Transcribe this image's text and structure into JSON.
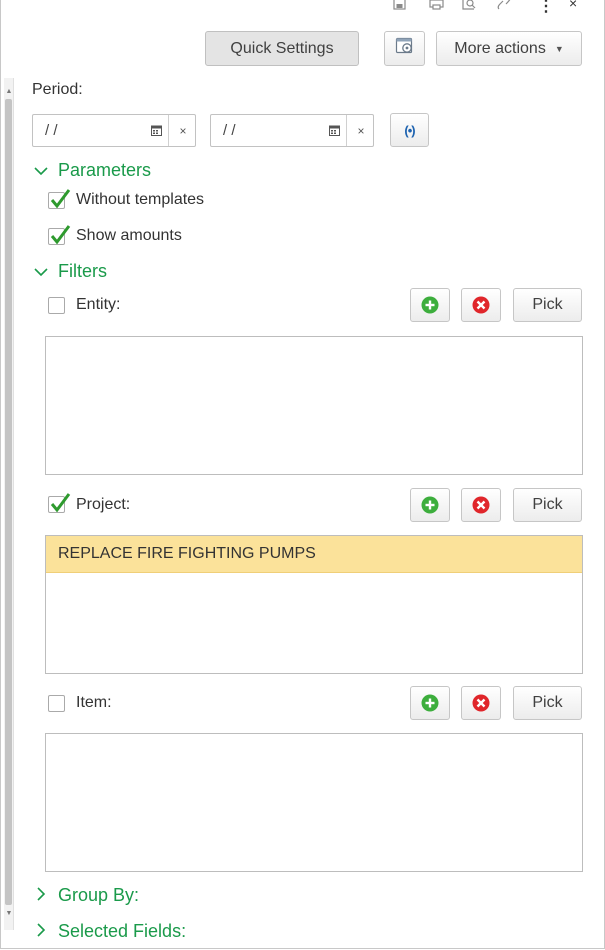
{
  "toolbar": {
    "quick_settings_label": "Quick Settings",
    "more_actions_label": "More actions",
    "settings_icon": "report-settings-icon",
    "top_icons": [
      "save-icon",
      "print-icon",
      "preview-icon",
      "link-icon",
      "more-vertical-icon",
      "close-icon"
    ]
  },
  "period": {
    "label": "Period:",
    "start_value": "/ /",
    "end_value": "/ /"
  },
  "parameters": {
    "title": "Parameters",
    "without_templates": {
      "label": "Without templates",
      "checked": true
    },
    "show_amounts": {
      "label": "Show amounts",
      "checked": true
    }
  },
  "filters": {
    "title": "Filters",
    "entity": {
      "label": "Entity:",
      "checked": false,
      "pick_label": "Pick",
      "items": []
    },
    "project": {
      "label": "Project:",
      "checked": true,
      "pick_label": "Pick",
      "items": [
        "REPLACE FIRE FIGHTING PUMPS"
      ]
    },
    "item": {
      "label": "Item:",
      "checked": false,
      "pick_label": "Pick",
      "items": []
    }
  },
  "group_by": {
    "title": "Group By:"
  },
  "selected_fields": {
    "title": "Selected Fields:"
  },
  "colors": {
    "accent_green": "#1a9a4a",
    "selected_row": "#fbe29a",
    "add_icon": "#3dae3d",
    "remove_icon": "#e0262b",
    "sync_icon": "#1e63b0"
  }
}
